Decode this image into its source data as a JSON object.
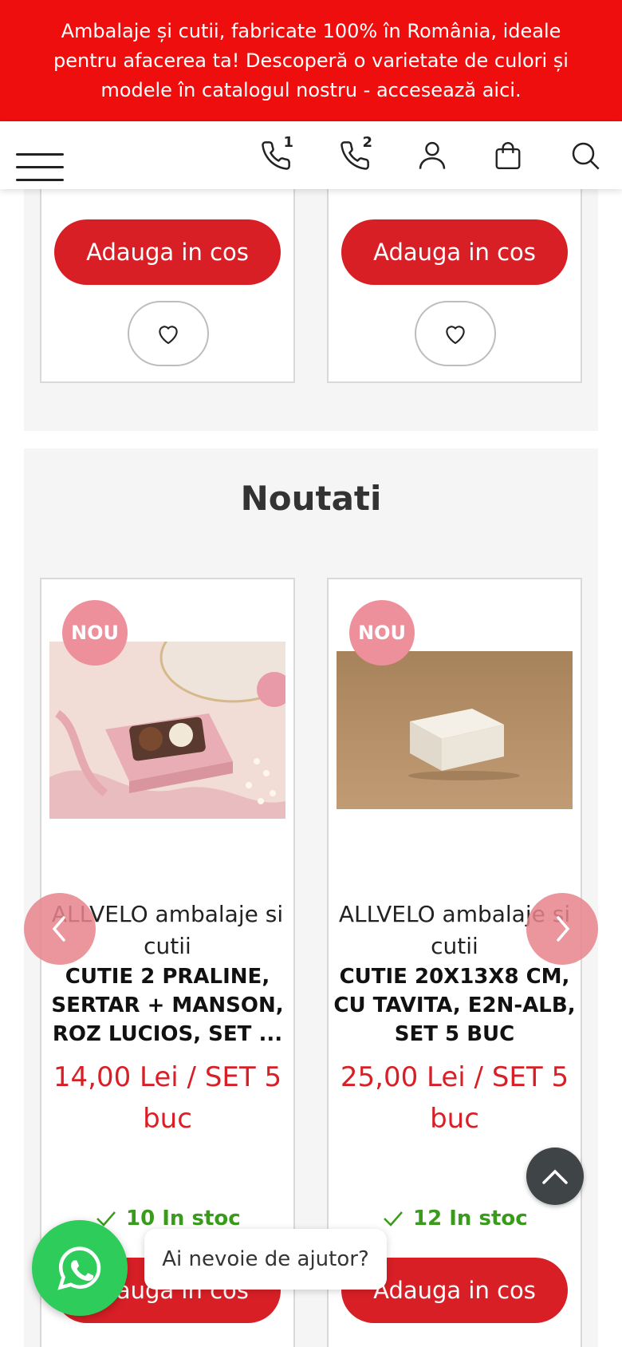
{
  "banner": {
    "text": "Ambalaje și cutii, fabricate 100% în România, ideale pentru afacerea ta! Descoperă o varietate de culori și modele în catalogul nostru - accesează aici."
  },
  "header": {
    "phone1_label": "1",
    "phone2_label": "2"
  },
  "top_cards": {
    "add_to_cart": "Adauga in cos"
  },
  "section": {
    "title": "Noutati"
  },
  "products": [
    {
      "badge": "NOU",
      "brand": "ALLVELO ambalaje si cutii",
      "name": "CUTIE 2 PRALINE, SERTAR + MANSON, ROZ LUCIOS, SET ...",
      "price": "14,00 Lei / SET 5 buc",
      "stock": "10 In stoc",
      "add_to_cart": "Adauga in cos"
    },
    {
      "badge": "NOU",
      "brand": "ALLVELO ambalaje si cutii",
      "name": "CUTIE 20X13X8 CM, CU TAVITA, E2N-ALB, SET 5 BUC",
      "price": "25,00 Lei / SET 5 buc",
      "stock": "12 In stoc",
      "add_to_cart": "Adauga in cos"
    }
  ],
  "chat": {
    "help_text": "Ai nevoie de ajutor?"
  },
  "colors": {
    "banner": "#ee0e0e",
    "primary": "#d81f26",
    "badge": "#ee8f9c",
    "stock": "#3a9a1c",
    "whatsapp": "#2ecc5b"
  }
}
